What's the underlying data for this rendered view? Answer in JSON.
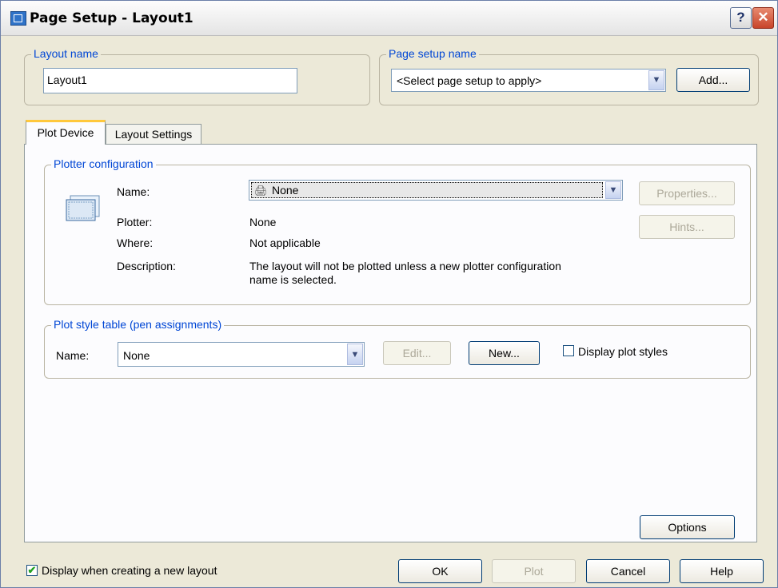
{
  "window": {
    "title": "Page Setup - Layout1",
    "help_glyph": "?",
    "close_glyph": "✕"
  },
  "layout_name": {
    "group_label": "Layout name",
    "value": "Layout1"
  },
  "page_setup_name": {
    "group_label": "Page setup name",
    "selected": "<Select page setup to apply>",
    "add_button": "Add..."
  },
  "tabs": [
    {
      "label": "Plot Device",
      "active": true
    },
    {
      "label": "Layout Settings",
      "active": false
    }
  ],
  "plotter_configuration": {
    "group_label": "Plotter configuration",
    "name_label": "Name:",
    "name_selected": "None",
    "plotter_label": "Plotter:",
    "plotter_value": "None",
    "where_label": "Where:",
    "where_value": "Not applicable",
    "description_label": "Description:",
    "description_line1": "The layout will not be plotted unless a new plotter configuration",
    "description_line2": "name is selected.",
    "properties_button": "Properties...",
    "hints_button": "Hints..."
  },
  "plot_style_table": {
    "group_label": "Plot style table (pen assignments)",
    "name_label": "Name:",
    "name_selected": "None",
    "edit_button": "Edit...",
    "new_button": "New...",
    "display_plot_styles_label": "Display plot styles",
    "display_plot_styles_checked": false
  },
  "options_button": "Options",
  "footer": {
    "display_when_creating_label": "Display when creating a new layout",
    "display_when_creating_checked": true,
    "ok_button": "OK",
    "plot_button": "Plot",
    "cancel_button": "Cancel",
    "help_button": "Help"
  },
  "colors": {
    "dialog_bg": "#ece9d8",
    "group_label": "#0046d5",
    "active_tab_accent": "#ffc83c",
    "disabled_text": "#aca899"
  }
}
